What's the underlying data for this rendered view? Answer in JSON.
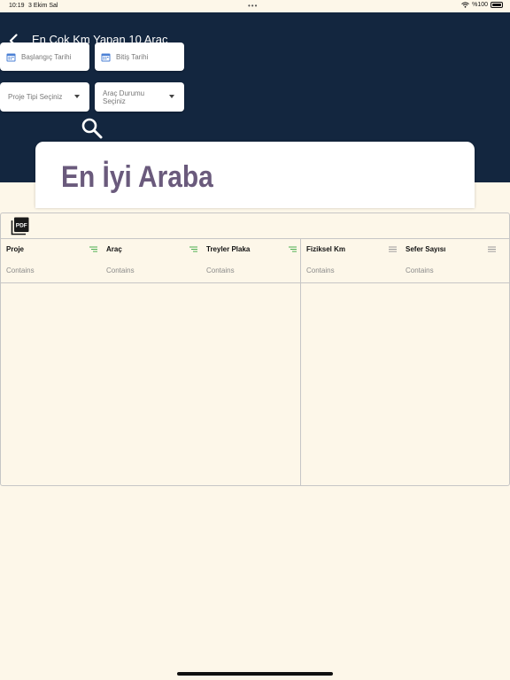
{
  "status_bar": {
    "time": "10:19",
    "date": "3 Ekim Sal",
    "battery": "%100"
  },
  "header": {
    "title": "En Çok Km Yapan 10 Araç"
  },
  "filters": {
    "start_date": "Başlangıç Tarihi",
    "end_date": "Bitiş Tarihi",
    "project_type": "Proje Tipi Seçiniz",
    "vehicle_status": "Araç Durumu Seçiniz"
  },
  "card": {
    "title": "En İyi Araba"
  },
  "grid": {
    "pdf_label": "PDF",
    "filter_placeholder": "Contains",
    "columns": [
      {
        "label": "Proje",
        "icon": "filter-active-icon"
      },
      {
        "label": "Araç",
        "icon": "filter-active-icon"
      },
      {
        "label": "Treyler Plaka",
        "icon": "filter-active-icon"
      },
      {
        "label": "Fiziksel Km",
        "icon": "menu-icon"
      },
      {
        "label": "Sefer Sayısı",
        "icon": "menu-icon"
      }
    ],
    "rows": []
  },
  "colors": {
    "header_bg": "#13263f",
    "page_bg": "#fdf7e9",
    "card_title": "#6a5a7c",
    "active_filter": "#4caf50",
    "calendar_icon": "#4a7fd4"
  }
}
